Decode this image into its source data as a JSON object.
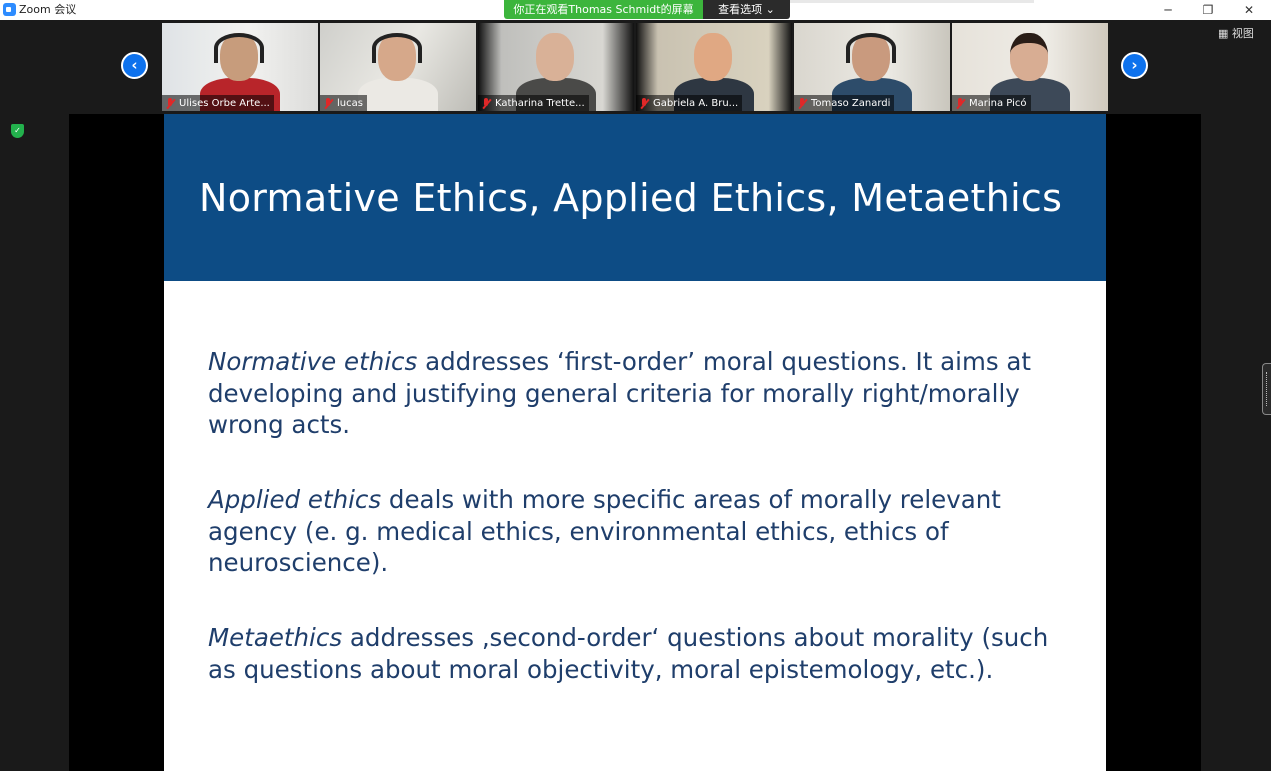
{
  "window": {
    "title": "Zoom 会议",
    "minimize": "─",
    "maximize": "❐",
    "close": "✕"
  },
  "share_banner": {
    "text": "你正在观看Thomas Schmidt的屏幕",
    "options_label": "查看选项 ⌄",
    "accent": "#3cb53c"
  },
  "toolbar": {
    "view_label": "▦ 视图",
    "prev_arrow": "‹",
    "next_arrow": "›"
  },
  "participants": [
    {
      "name": "Ulises Orbe Arte...",
      "muted": true
    },
    {
      "name": "lucas",
      "muted": true
    },
    {
      "name": "Katharina Trette...",
      "muted": true
    },
    {
      "name": "Gabriela A. Bru...",
      "muted": true
    },
    {
      "name": "Tomaso Zanardi",
      "muted": true
    },
    {
      "name": "Marina Picó",
      "muted": true
    }
  ],
  "slide": {
    "title": "Normative Ethics, Applied Ethics, Metaethics",
    "header_color": "#0d4c85",
    "text_color": "#1f3e6b",
    "paragraphs": [
      {
        "term": "Normative ethics",
        "rest": " addresses ‘first-order’ moral questions. It aims at developing and justifying general criteria for morally right/morally wrong acts."
      },
      {
        "term": "Applied ethics",
        "rest": " deals with more specific areas of morally relevant agency (e. g. medical ethics, environmental ethics, ethics of neuroscience)."
      },
      {
        "term": "Metaethics",
        "rest": " addresses ‚second-order‘ questions about morality (such as questions about moral objectivity, moral epistemology, etc.)."
      }
    ]
  }
}
